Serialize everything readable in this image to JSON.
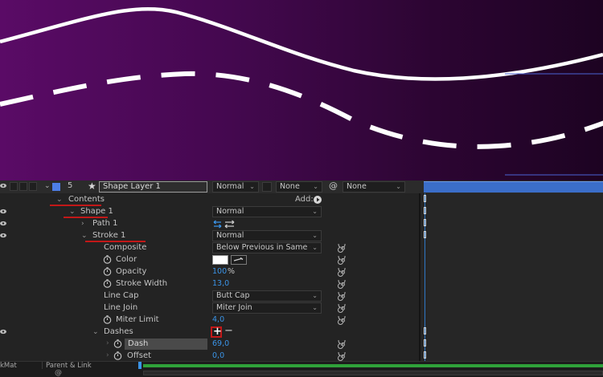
{
  "layer": {
    "number": "5",
    "name": "Shape Layer 1",
    "mode": "Normal",
    "trkmat": "None",
    "parent": "None"
  },
  "contents": {
    "label": "Contents",
    "add_label": "Add:"
  },
  "shape": {
    "label": "Shape 1",
    "mode": "Normal"
  },
  "path": {
    "label": "Path 1"
  },
  "stroke": {
    "label": "Stroke 1",
    "mode": "Normal",
    "composite_label": "Composite",
    "composite_value": "Below Previous in Same G",
    "color_label": "Color",
    "opacity_label": "Opacity",
    "opacity_value": "100",
    "opacity_unit": "%",
    "width_label": "Stroke Width",
    "width_value": "13,0",
    "linecap_label": "Line Cap",
    "linecap_value": "Butt Cap",
    "linejoin_label": "Line Join",
    "linejoin_value": "Miter Join",
    "miter_label": "Miter Limit",
    "miter_value": "4,0",
    "dashes_label": "Dashes",
    "dash_label": "Dash",
    "dash_value": "69,0",
    "offset_label": "Offset",
    "offset_value": "0,0"
  },
  "bottom": {
    "trkmat_tab": "kMat",
    "parent_tab": "Parent & Link"
  },
  "colors": {
    "accent": "#3a93e6",
    "highlight_red": "#c21818",
    "layer_label": "#4d7ee6",
    "stroke_color": "#ffffff",
    "timeline_bar": "#3b6ec9",
    "work_area_green": "#2fa23a"
  }
}
